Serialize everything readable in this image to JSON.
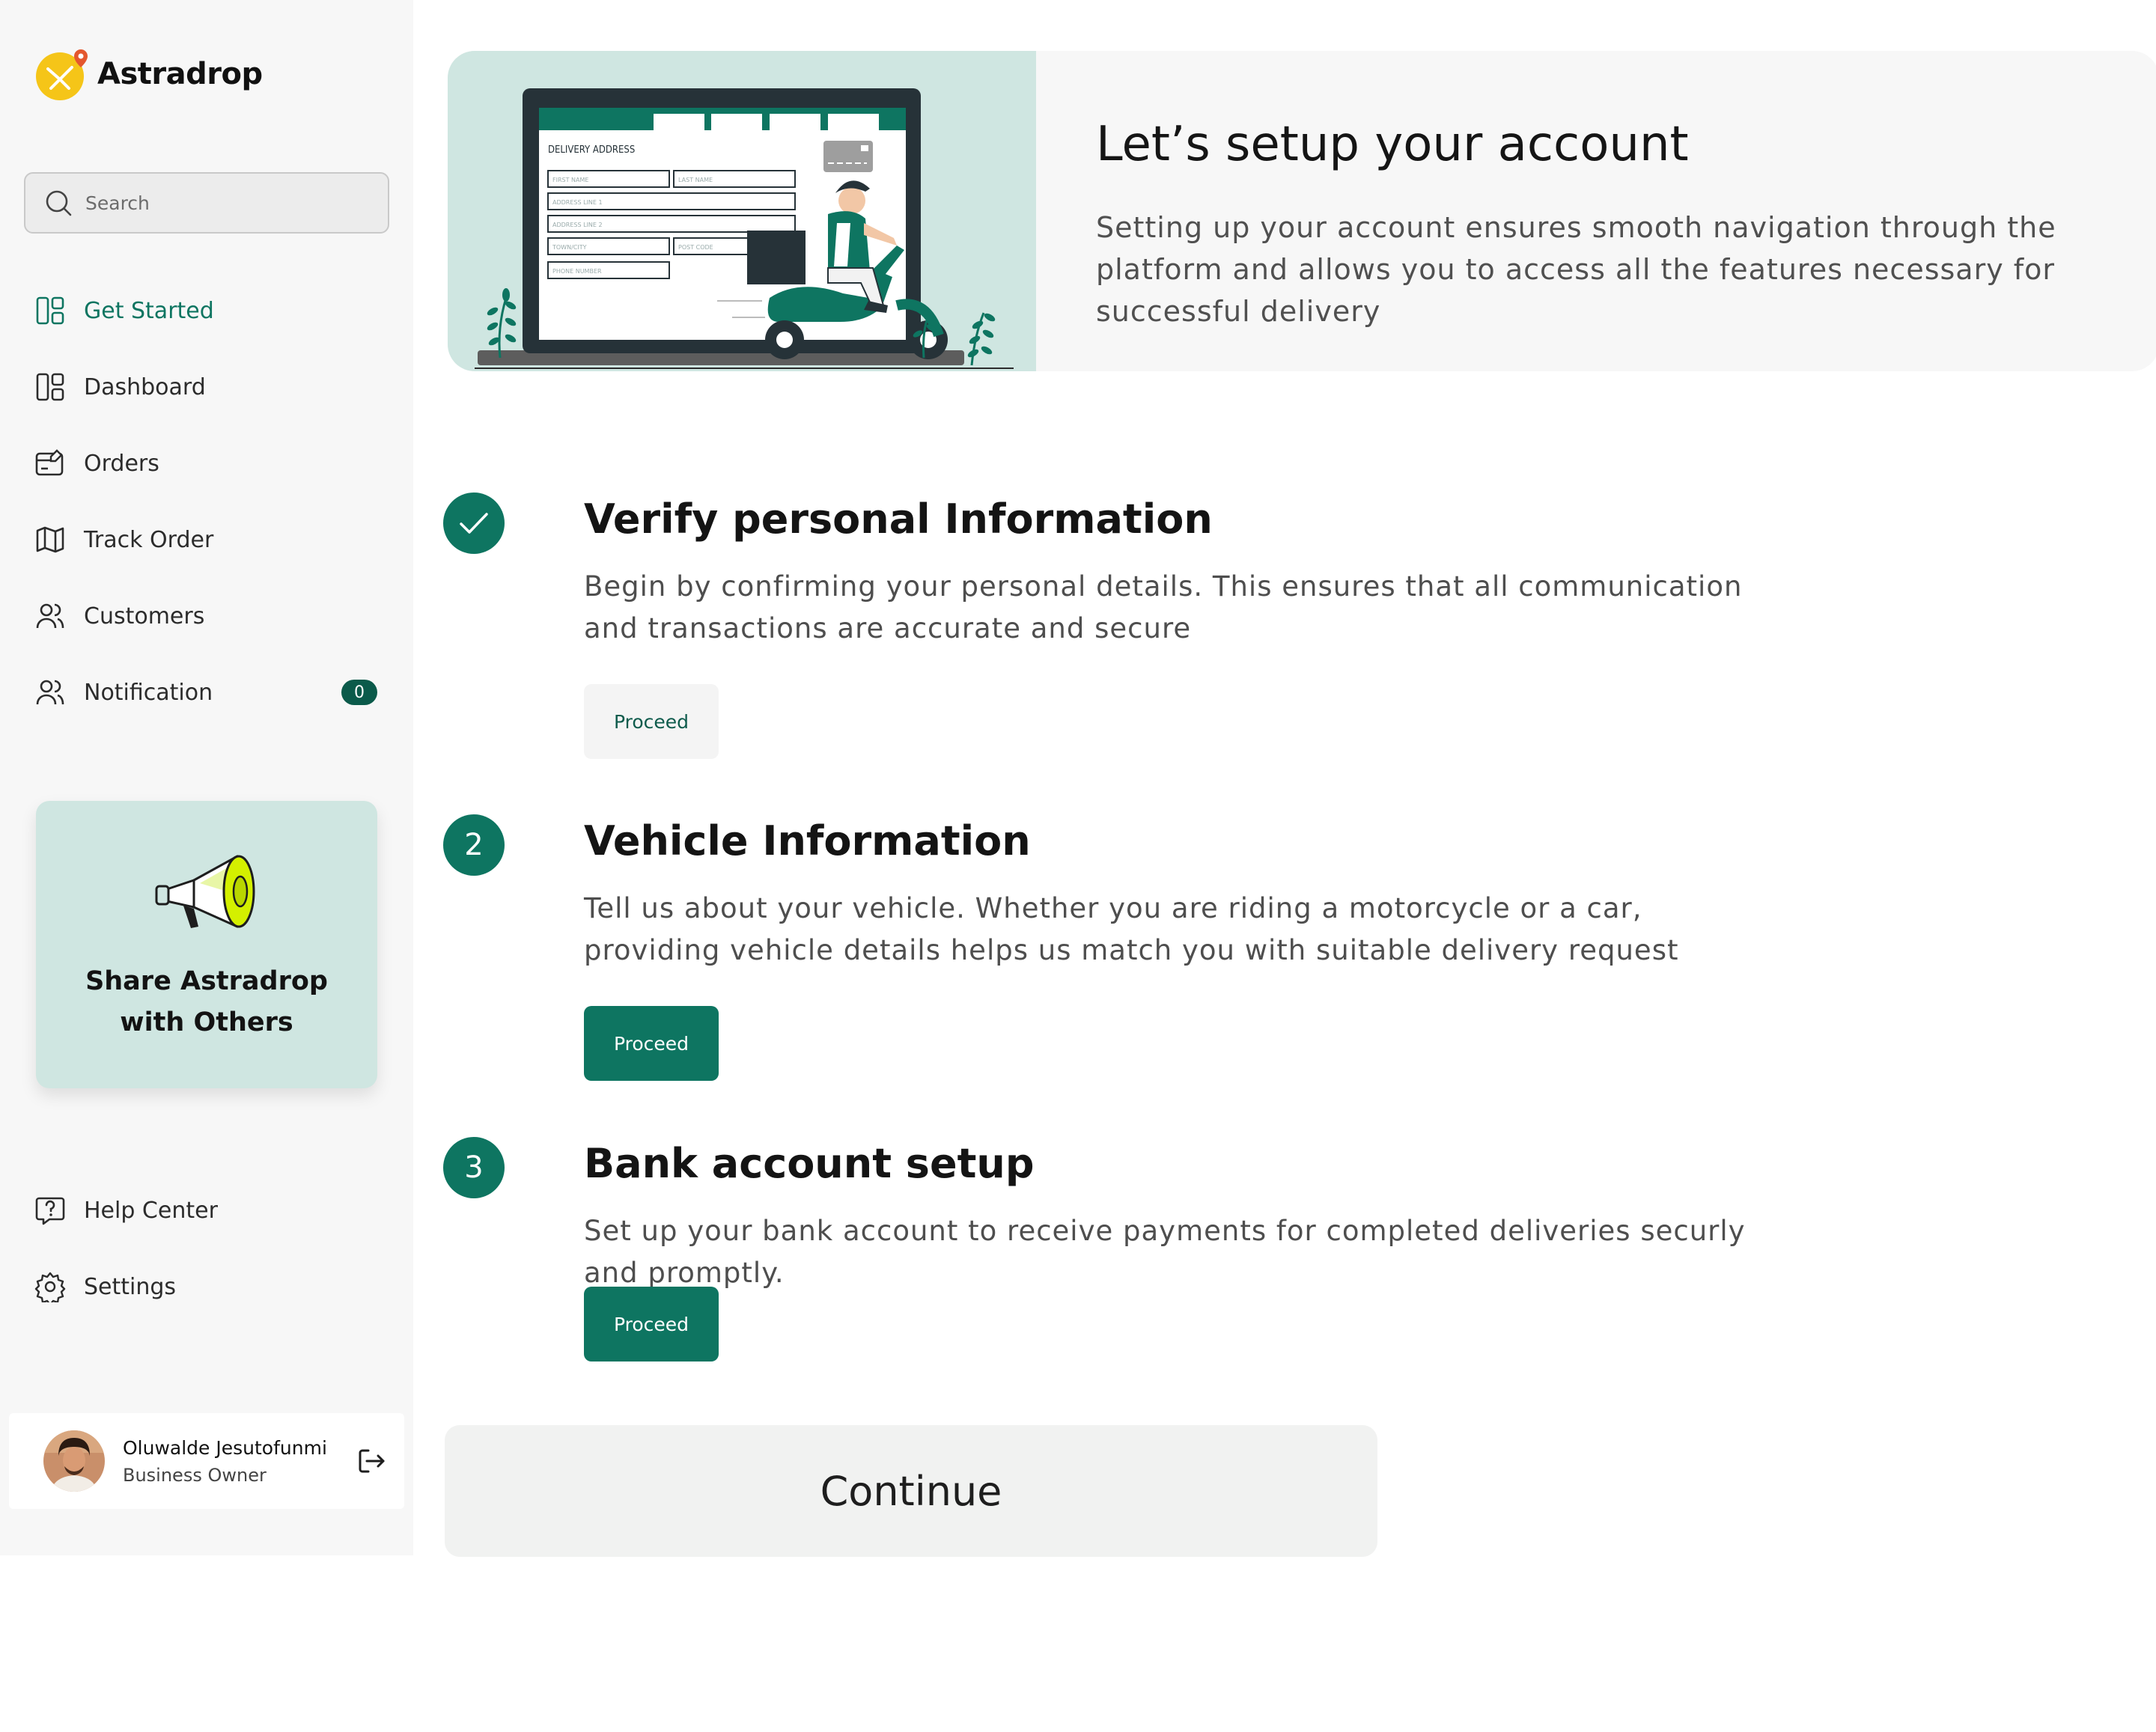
{
  "app": {
    "name": "Astradrop"
  },
  "search": {
    "placeholder": "Search"
  },
  "sidebar": {
    "items": [
      {
        "label": "Get Started",
        "icon": "layout-icon",
        "active": true
      },
      {
        "label": "Dashboard",
        "icon": "layout-icon"
      },
      {
        "label": "Orders",
        "icon": "orders-icon"
      },
      {
        "label": "Track Order",
        "icon": "map-icon"
      },
      {
        "label": "Customers",
        "icon": "users-icon"
      },
      {
        "label": "Notification",
        "icon": "users-icon",
        "badge": "0"
      }
    ],
    "bottom_items": [
      {
        "label": "Help Center",
        "icon": "help-icon"
      },
      {
        "label": "Settings",
        "icon": "gear-icon"
      }
    ]
  },
  "share_card": {
    "text": "Share Astradrop with Others"
  },
  "user": {
    "name": "Oluwalde Jesutofunmi",
    "role": "Business Owner"
  },
  "hero": {
    "title": "Let’s setup your account",
    "description": "Setting up your account ensures smooth navigation through the platform and allows you to access all the features necessary for successful delivery",
    "form_labels": {
      "heading": "DELIVERY ADDRESS",
      "first_name": "FIRST NAME",
      "last_name": "LAST NAME",
      "address1": "ADDRESS LINE 1",
      "address2": "ADDRESS LINE 2",
      "town": "TOWN/CITY",
      "post_code": "POST CODE",
      "phone": "PHONE NUMBER"
    }
  },
  "steps": [
    {
      "number": "✓",
      "completed": true,
      "title": "Verify personal Information",
      "description": "Begin by confirming your personal details. This ensures that all communication and transactions are accurate and secure",
      "button": "Proceed"
    },
    {
      "number": "2",
      "title": "Vehicle Information",
      "description": "Tell us about your vehicle. Whether you are riding a motorcycle or a car, providing vehicle details helps us match you with suitable delivery request",
      "button": "Proceed"
    },
    {
      "number": "3",
      "title": "Bank account setup",
      "description": "Set up your bank account to receive payments for completed deliveries securly and promptly.",
      "button": "Proceed"
    }
  ],
  "continue_label": "Continue",
  "colors": {
    "primary": "#0e7561",
    "mint": "#cfe6e1",
    "sidebar_bg": "#f7f7f7",
    "logo_yellow": "#f5c518",
    "logo_pin": "#e4572e"
  }
}
